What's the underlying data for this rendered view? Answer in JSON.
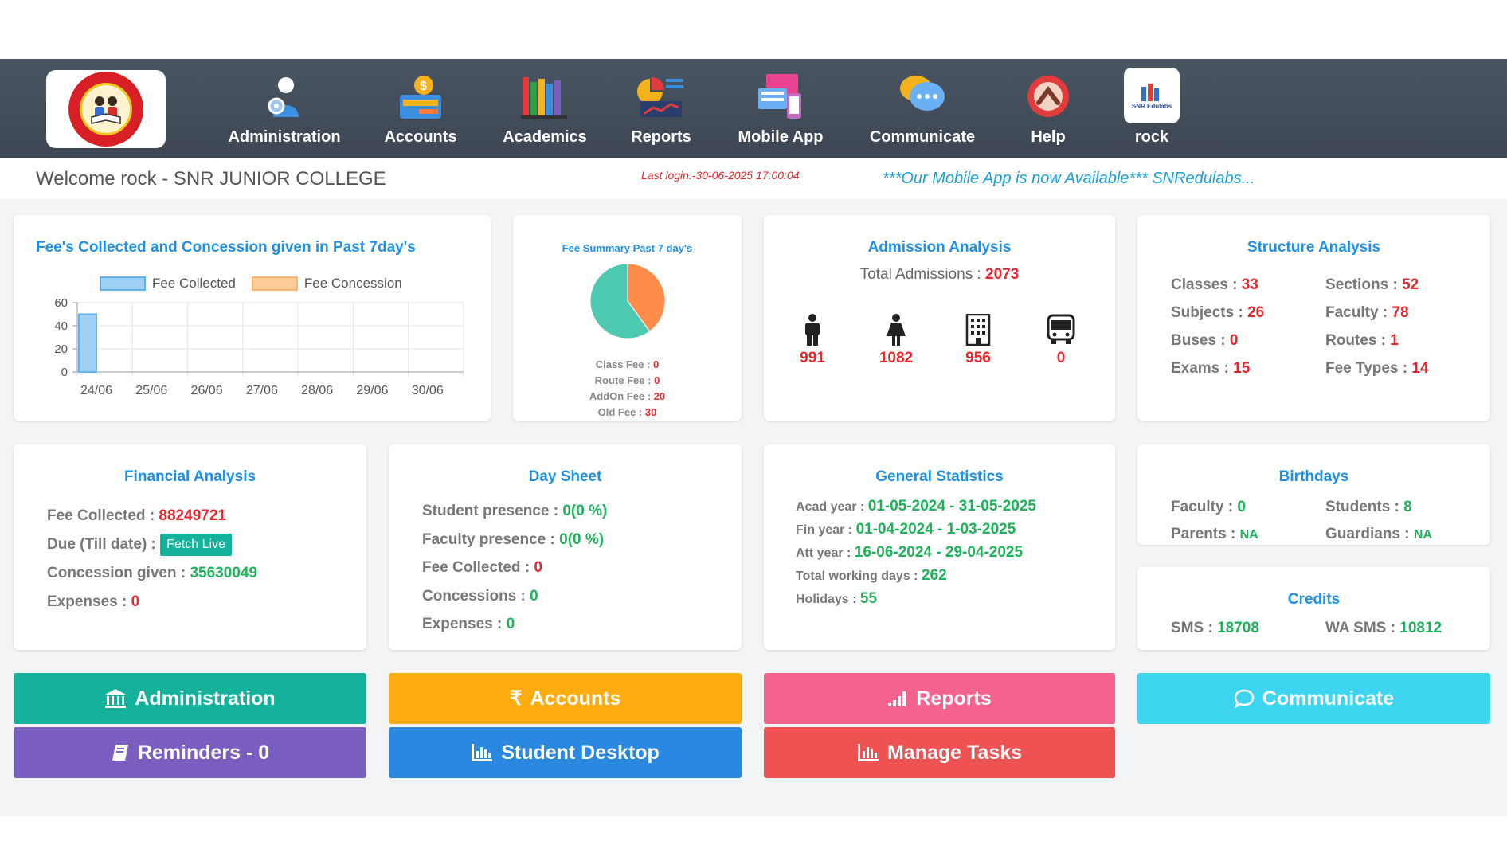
{
  "nav": {
    "items": [
      {
        "label": "Administration",
        "icon": "admin-icon"
      },
      {
        "label": "Accounts",
        "icon": "accounts-icon"
      },
      {
        "label": "Academics",
        "icon": "academics-icon"
      },
      {
        "label": "Reports",
        "icon": "reports-icon"
      },
      {
        "label": "Mobile App",
        "icon": "mobile-app-icon"
      },
      {
        "label": "Communicate",
        "icon": "communicate-icon"
      },
      {
        "label": "Help",
        "icon": "help-icon"
      },
      {
        "label": "rock",
        "icon": "user-avatar-icon"
      }
    ],
    "rock_logo_text": "SNR Edulabs"
  },
  "welcome": "Welcome rock - SNR JUNIOR COLLEGE",
  "last_login": "Last login:-30-06-2025 17:00:04",
  "marquee": "***Our Mobile App is now Available*** SNRedulabs...",
  "fee_chart": {
    "title": "Fee's Collected and Concession given in Past 7day's",
    "legend": [
      "Fee Collected",
      "Fee Concession"
    ],
    "colors": {
      "collected": "#9fd0f5",
      "collected_border": "#62b2ee",
      "concession": "#ffcc99"
    }
  },
  "chart_data": [
    {
      "type": "bar",
      "title": "Fee's Collected and Concession given in Past 7day's",
      "categories": [
        "24/06",
        "25/06",
        "26/06",
        "27/06",
        "28/06",
        "29/06",
        "30/06"
      ],
      "series": [
        {
          "name": "Fee Collected",
          "values": [
            50,
            0,
            0,
            0,
            0,
            0,
            0
          ]
        },
        {
          "name": "Fee Concession",
          "values": [
            0,
            0,
            0,
            0,
            0,
            0,
            0
          ]
        }
      ],
      "yticks": [
        0,
        20,
        40,
        60
      ],
      "ylim": [
        0,
        60
      ],
      "grid": true,
      "legend": "top"
    },
    {
      "type": "pie",
      "title": "Fee Summary Past 7 day's",
      "labels": [
        "Class Fee",
        "Route Fee",
        "AddOn Fee",
        "Old Fee"
      ],
      "values": [
        0,
        0,
        20,
        30
      ],
      "colors": [
        "#4cc9b0",
        "#ff8c4a"
      ]
    }
  ],
  "fee_summary": {
    "title": "Fee Summary Past 7 day's",
    "rows": [
      {
        "label": "Class Fee : ",
        "value": "0"
      },
      {
        "label": "Route Fee : ",
        "value": "0"
      },
      {
        "label": "AddOn Fee : ",
        "value": "20"
      },
      {
        "label": "Old Fee : ",
        "value": "30"
      }
    ]
  },
  "admission": {
    "title": "Admission Analysis",
    "total_label": "Total Admissions : ",
    "total_value": "2073",
    "stats": [
      {
        "icon": "male-icon",
        "value": "991"
      },
      {
        "icon": "female-icon",
        "value": "1082"
      },
      {
        "icon": "building-icon",
        "value": "956"
      },
      {
        "icon": "bus-icon",
        "value": "0"
      }
    ]
  },
  "structure": {
    "title": "Structure Analysis",
    "items": [
      {
        "label": "Classes : ",
        "value": "33"
      },
      {
        "label": "Sections : ",
        "value": "52"
      },
      {
        "label": "Subjects : ",
        "value": "26"
      },
      {
        "label": "Faculty : ",
        "value": "78"
      },
      {
        "label": "Buses : ",
        "value": "0"
      },
      {
        "label": "Routes : ",
        "value": "1"
      },
      {
        "label": "Exams : ",
        "value": "15"
      },
      {
        "label": "Fee Types : ",
        "value": "14"
      }
    ]
  },
  "financial": {
    "title": "Financial Analysis",
    "fee_collected_label": "Fee Collected : ",
    "fee_collected": "88249721",
    "due_label": "Due (Till date) : ",
    "fetch_live": "Fetch Live",
    "concession_label": "Concession given : ",
    "concession": "35630049",
    "expenses_label": "Expenses : ",
    "expenses": "0"
  },
  "day_sheet": {
    "title": "Day Sheet",
    "items": [
      {
        "label": "Student presence : ",
        "value": "0(0 %)"
      },
      {
        "label": "Faculty presence : ",
        "value": "0(0 %)"
      },
      {
        "label": "Fee Collected : ",
        "value": "0"
      },
      {
        "label": "Concessions : ",
        "value": "0"
      },
      {
        "label": "Expenses : ",
        "value": "0"
      }
    ]
  },
  "general": {
    "title": "General Statistics",
    "items": [
      {
        "label": "Acad year : ",
        "value": "01-05-2024 - 31-05-2025"
      },
      {
        "label": "Fin year : ",
        "value": "01-04-2024 - 1-03-2025"
      },
      {
        "label": "Att year : ",
        "value": "16-06-2024 - 29-04-2025"
      },
      {
        "label": "Total working days : ",
        "value": "262"
      },
      {
        "label": "Holidays : ",
        "value": "55"
      }
    ]
  },
  "birthdays": {
    "title": "Birthdays",
    "items": [
      {
        "label": "Faculty : ",
        "value": "0"
      },
      {
        "label": "Students : ",
        "value": "8"
      },
      {
        "label": "Parents : ",
        "value": "NA"
      },
      {
        "label": "Guardians : ",
        "value": "NA"
      }
    ]
  },
  "credits": {
    "title": "Credits",
    "items": [
      {
        "label": "SMS : ",
        "value": "18708"
      },
      {
        "label": "WA SMS : ",
        "value": "10812"
      }
    ]
  },
  "buttons": {
    "administration": "Administration",
    "accounts": "Accounts",
    "reports": "Reports",
    "communicate": "Communicate",
    "reminders": "Reminders - 0",
    "student_desktop": "Student Desktop",
    "manage_tasks": "Manage Tasks"
  },
  "colors": {
    "nav_bg": "#424b57",
    "title_blue": "#1f8fe5",
    "value_red": "#e8262c",
    "value_green": "#20b25a",
    "btn_admin": "#14b29b",
    "btn_accounts": "#fcab10",
    "btn_reports": "#f4628e",
    "btn_communicate": "#3dd5f0",
    "btn_reminders": "#7a5fc0",
    "btn_student": "#2a88e0",
    "btn_tasks": "#ee5253"
  }
}
